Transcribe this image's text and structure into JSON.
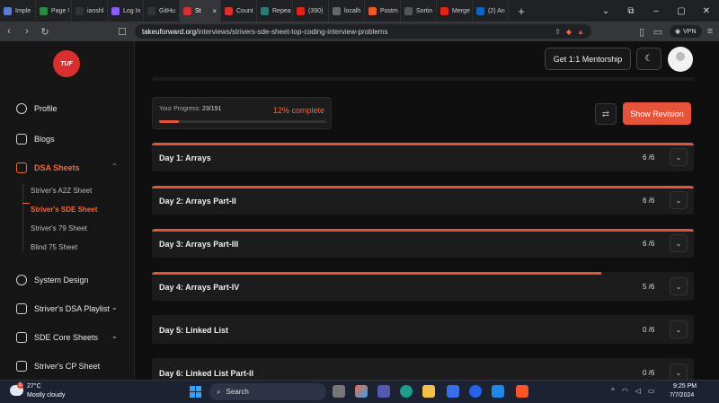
{
  "browser": {
    "tabs": [
      {
        "label": "Imple",
        "favicon": "cloud-icon",
        "color": "#5b7bd5"
      },
      {
        "label": "Page !",
        "favicon": "leaf-icon",
        "color": "#2c8a3e"
      },
      {
        "label": "ianshl",
        "favicon": "github-icon",
        "color": "#333333"
      },
      {
        "label": "Log In",
        "favicon": "purple-logo-icon",
        "color": "#8b5cf6"
      },
      {
        "label": "GitHu",
        "favicon": "github-icon",
        "color": "#333333"
      },
      {
        "label": "St",
        "favicon": "tuf-icon",
        "color": "#d92f2f",
        "active": true
      },
      {
        "label": "Count",
        "favicon": "tuf-icon",
        "color": "#d92f2f"
      },
      {
        "label": "Repea",
        "favicon": "arrow-icon",
        "color": "#2b7a78"
      },
      {
        "label": "(390)",
        "favicon": "youtube-icon",
        "color": "#e62117"
      },
      {
        "label": "localh",
        "favicon": "globe-icon",
        "color": "#666666"
      },
      {
        "label": "Postm",
        "favicon": "postman-icon",
        "color": "#ef5b25"
      },
      {
        "label": "Sortin",
        "favicon": "settings-icon",
        "color": "#555555"
      },
      {
        "label": "Merge",
        "favicon": "youtube-icon",
        "color": "#e62117"
      },
      {
        "label": "(2) An",
        "favicon": "linkedin-icon",
        "color": "#0a66c2"
      }
    ],
    "close_glyph": "×",
    "new_tab": "+",
    "window_controls": [
      "⌄",
      "⧉",
      "–",
      "▢",
      "✕"
    ],
    "url_host": "takeuforward.org",
    "url_path": "/interviews/strivers-sde-sheet-top-coding-interview-problems",
    "vpn_label": "VPN",
    "nav_glyphs": {
      "back": "‹",
      "forward": "›",
      "reload": "↻",
      "bookmark": "☐"
    }
  },
  "sidebar": {
    "logo": "TUF",
    "items": {
      "profile": "Profile",
      "blogs": "Blogs",
      "dsa": "DSA Sheets",
      "system_design": "System Design",
      "dsa_playlist": "Striver's DSA Playlist",
      "sde_core": "SDE Core Sheets",
      "cp_sheet": "Striver's CP Sheet"
    },
    "sub_items": [
      "Striver's A2Z Sheet",
      "Striver's SDE Sheet",
      "Striver's 79 Sheet",
      "Blind 75 Sheet"
    ],
    "chevron_up": "⌃",
    "chevron_down": "⌄"
  },
  "header": {
    "mentorship": "Get 1:1 Mentorship",
    "theme_glyph": "☾"
  },
  "progress": {
    "label": "Your Progress:",
    "value": "23/191",
    "percent_text": "12% complete",
    "fraction": 0.12
  },
  "actions": {
    "shuffle_glyph": "⇄",
    "revision": "Show Revision"
  },
  "days": [
    {
      "title": "Day 1: Arrays",
      "count": "6 /6",
      "progress": 1.0
    },
    {
      "title": "Day 2: Arrays Part-II",
      "count": "6 /6",
      "progress": 1.0
    },
    {
      "title": "Day 3: Arrays Part-III",
      "count": "6 /6",
      "progress": 1.0
    },
    {
      "title": "Day 4: Arrays Part-IV",
      "count": "5 /6",
      "progress": 0.83
    },
    {
      "title": "Day 5: Linked List",
      "count": "0 /6",
      "progress": 0
    },
    {
      "title": "Day 6: Linked List Part-II",
      "count": "0 /6",
      "progress": 0
    }
  ],
  "taskbar": {
    "temp": "27°C",
    "weather": "Mostly cloudy",
    "badge": "1",
    "search": "Search",
    "tray": "^",
    "time": "9:25 PM",
    "date": "7/7/2024"
  }
}
